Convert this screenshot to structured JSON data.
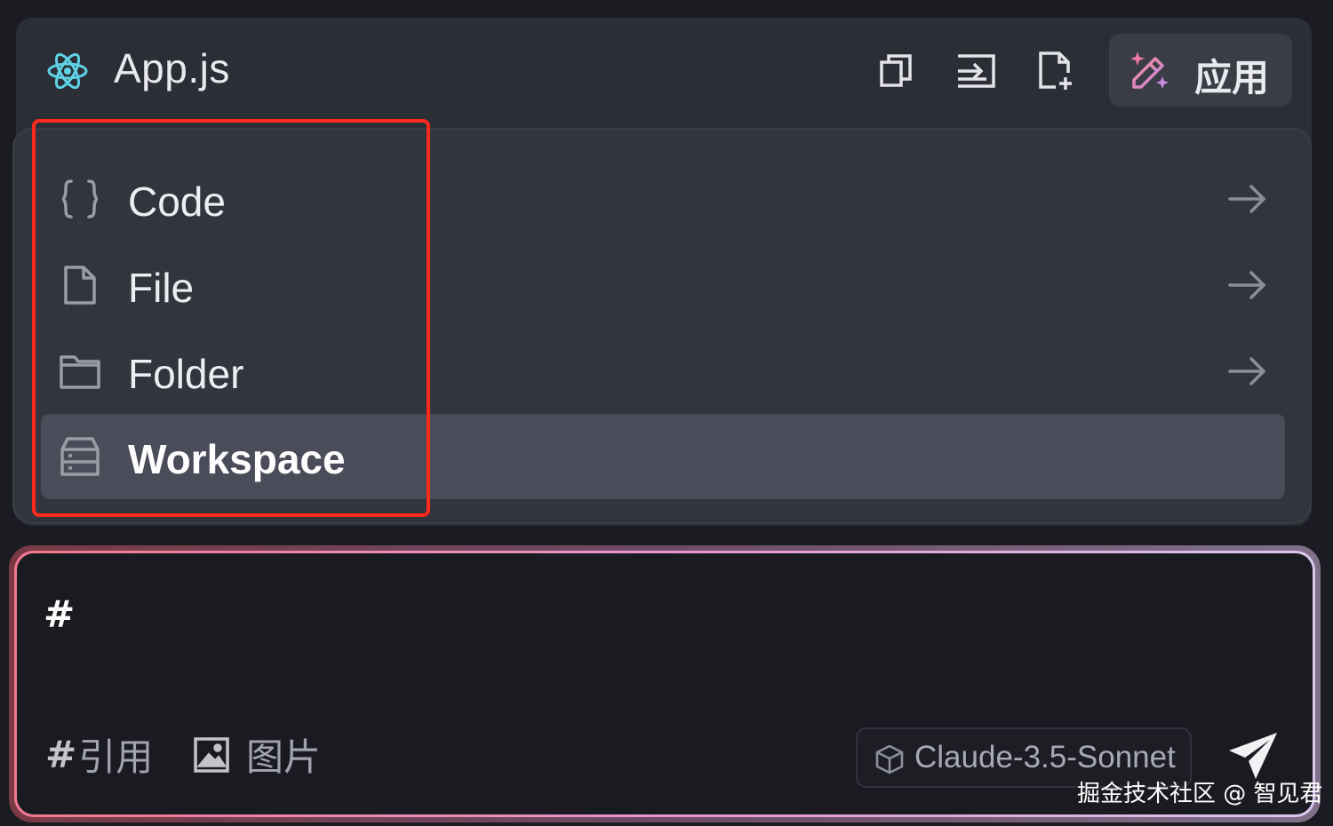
{
  "header": {
    "file_title": "App.js",
    "file_icon": "react-icon",
    "actions": [
      {
        "name": "copy-icon"
      },
      {
        "name": "insert-icon"
      },
      {
        "name": "new-file-icon"
      }
    ],
    "apply_label": "应用",
    "apply_icon": "magic-wand-icon"
  },
  "menu": {
    "items": [
      {
        "label": "Code",
        "icon": "code-braces-icon",
        "has_arrow": true,
        "active": false
      },
      {
        "label": "File",
        "icon": "file-icon",
        "has_arrow": true,
        "active": false
      },
      {
        "label": "Folder",
        "icon": "folder-icon",
        "has_arrow": true,
        "active": false
      },
      {
        "label": "Workspace",
        "icon": "workspace-icon",
        "has_arrow": false,
        "active": true
      }
    ]
  },
  "input": {
    "value": "#",
    "toolbar": {
      "reference_hash": "#",
      "reference_label": "引用",
      "image_label": "图片"
    },
    "model_name": "Claude-3.5-Sonnet"
  },
  "watermark": "掘金技术社区 @ 智见君",
  "colors": {
    "highlight_border": "#ff2a1a",
    "active_item_bg": "#4a4c59",
    "react_icon": "#5ed3e6",
    "wand_pink": "#f07aa5"
  }
}
